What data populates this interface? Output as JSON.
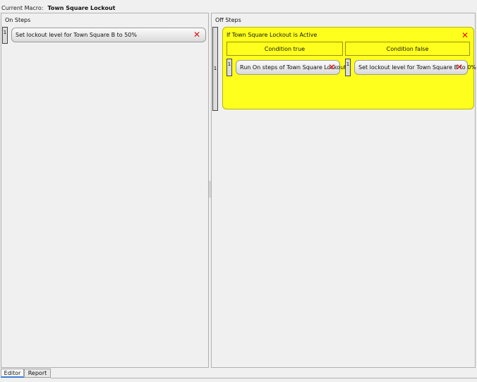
{
  "header": {
    "label": "Current Macro:",
    "macro_name": "Town Square Lockout"
  },
  "on_steps": {
    "title": "On Steps",
    "items": [
      {
        "index": "1",
        "label": "Set lockout level for Town Square B to 50%"
      }
    ]
  },
  "off_steps": {
    "title": "Off Steps",
    "index": "1",
    "condition": {
      "title": "If Town Square Lockout is Active",
      "true_header": "Condition true",
      "false_header": "Condition false",
      "true_items": [
        {
          "index": "1",
          "label": "Run On steps of Town Square Lockout"
        }
      ],
      "false_items": [
        {
          "index": "1",
          "label": "Set lockout level for Town Square B to 0%"
        }
      ]
    }
  },
  "delete_icon": "close-icon",
  "delete_symbol": "✕",
  "tabs": [
    {
      "label": "Editor",
      "active": true
    },
    {
      "label": "Report",
      "active": false
    }
  ],
  "colors": {
    "condition_background": "#ffff1e",
    "delete_x": "#e01010",
    "active_tab_underline": "#3b7fd3"
  }
}
